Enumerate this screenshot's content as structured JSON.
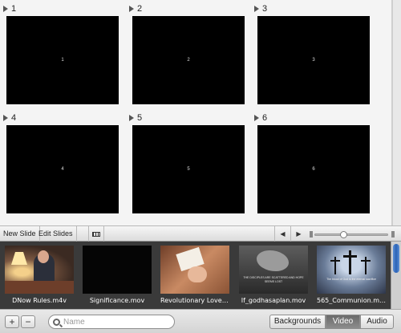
{
  "slides": [
    {
      "number": "1",
      "thumb_label": "1"
    },
    {
      "number": "2",
      "thumb_label": "2"
    },
    {
      "number": "3",
      "thumb_label": "3"
    },
    {
      "number": "4",
      "thumb_label": "4"
    },
    {
      "number": "5",
      "thumb_label": "5"
    },
    {
      "number": "6",
      "thumb_label": "6"
    }
  ],
  "toolbar": {
    "new_slide": "New Slide",
    "edit_slides": "Edit Slides",
    "grid_icon": "grid-view-icon",
    "prev_icon": "previous-arrow-icon",
    "next_icon": "next-arrow-icon",
    "prev_glyph": "◀",
    "next_glyph": "▶",
    "zoom_level": 0.4
  },
  "media": {
    "items": [
      {
        "name": "DNow Rules.m4v"
      },
      {
        "name": "Significance.mov"
      },
      {
        "name": "Revolutionary Love.mov"
      },
      {
        "name": "If_godhasaplan.mov",
        "caption": "THE DISCIPLES ARE SCATTERED AND HOPE SEEMS LOST"
      },
      {
        "name": "565_Communion.mov",
        "caption": "The blood of God is the eternal sacrifice"
      }
    ]
  },
  "bottom": {
    "add_label": "+",
    "remove_label": "−",
    "search_placeholder": "Name",
    "tabs": [
      {
        "label": "Backgrounds",
        "active": false
      },
      {
        "label": "Video",
        "active": true
      },
      {
        "label": "Audio",
        "active": false
      }
    ]
  }
}
